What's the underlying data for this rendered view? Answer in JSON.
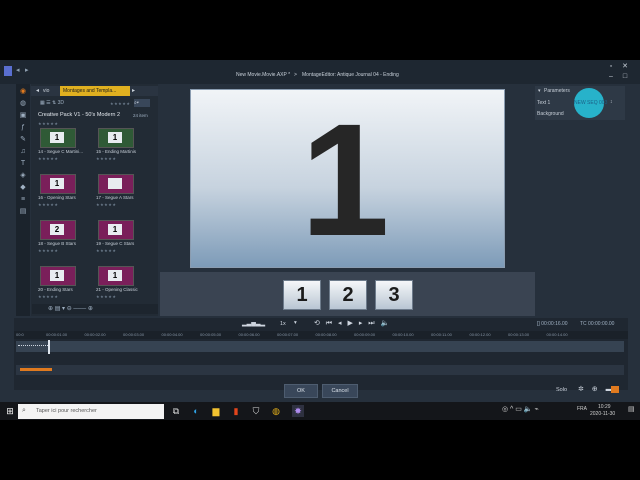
{
  "window": {
    "project_title": "New Movie.Movie.AXP *",
    "separator": ">",
    "editor_title": "MontageEditor: Antique Journal  04 - Ending"
  },
  "browser": {
    "tab_left": "vio",
    "tab_active": "Montages and Templa...",
    "collection": "Creative Pack V1 - 50's Modern 2",
    "count": "24 item",
    "items": [
      {
        "caption": "14 - Segue C Martini...",
        "num": "1",
        "color": "green"
      },
      {
        "caption": "15 - Ending Martinis",
        "num": "1",
        "color": "green"
      },
      {
        "caption": "16 - Opening Stars",
        "num": "1",
        "color": "purple"
      },
      {
        "caption": "17 - Segue A Stars",
        "num": "",
        "color": "purple"
      },
      {
        "caption": "18 - Segue B Stars",
        "num": "2",
        "color": "purple"
      },
      {
        "caption": "19 - Segue C Stars",
        "num": "1",
        "color": "purple"
      },
      {
        "caption": "20 - Ending Stars",
        "num": "1",
        "color": "purple"
      },
      {
        "caption": "21 - Opening Classic",
        "num": "1",
        "color": "purple"
      }
    ]
  },
  "preview": {
    "big_number": "1"
  },
  "dock": {
    "numbers": [
      "1",
      "2",
      "3"
    ]
  },
  "params": {
    "header": "Parameters",
    "text_label": "Text 1",
    "text_value": "NEW SEQ 003",
    "bg_label": "Background"
  },
  "timeline": {
    "speed": "1x",
    "timecode_left": "[] 00:00:16.00",
    "timecode_right": "TC 00:00:00.00",
    "ticks": [
      "00:00:01.00",
      "00:00:02.00",
      "00:00:03.00",
      "00:00:04.00",
      "00:00:05.00",
      "00:00:06.00",
      "00:00:07.00",
      "00:00:08.00",
      "00:00:09.00",
      "00:00:10.00",
      "00:00:11.00",
      "00:00:12.00",
      "00:00:13.00",
      "00:00:14.00"
    ]
  },
  "buttons": {
    "ok": "OK",
    "cancel": "Cancel",
    "solo": "Solo"
  },
  "taskbar": {
    "search_placeholder": "Taper ici pour rechercher",
    "lang": "FRA",
    "time": "10:29",
    "date": "2020-11-30"
  }
}
